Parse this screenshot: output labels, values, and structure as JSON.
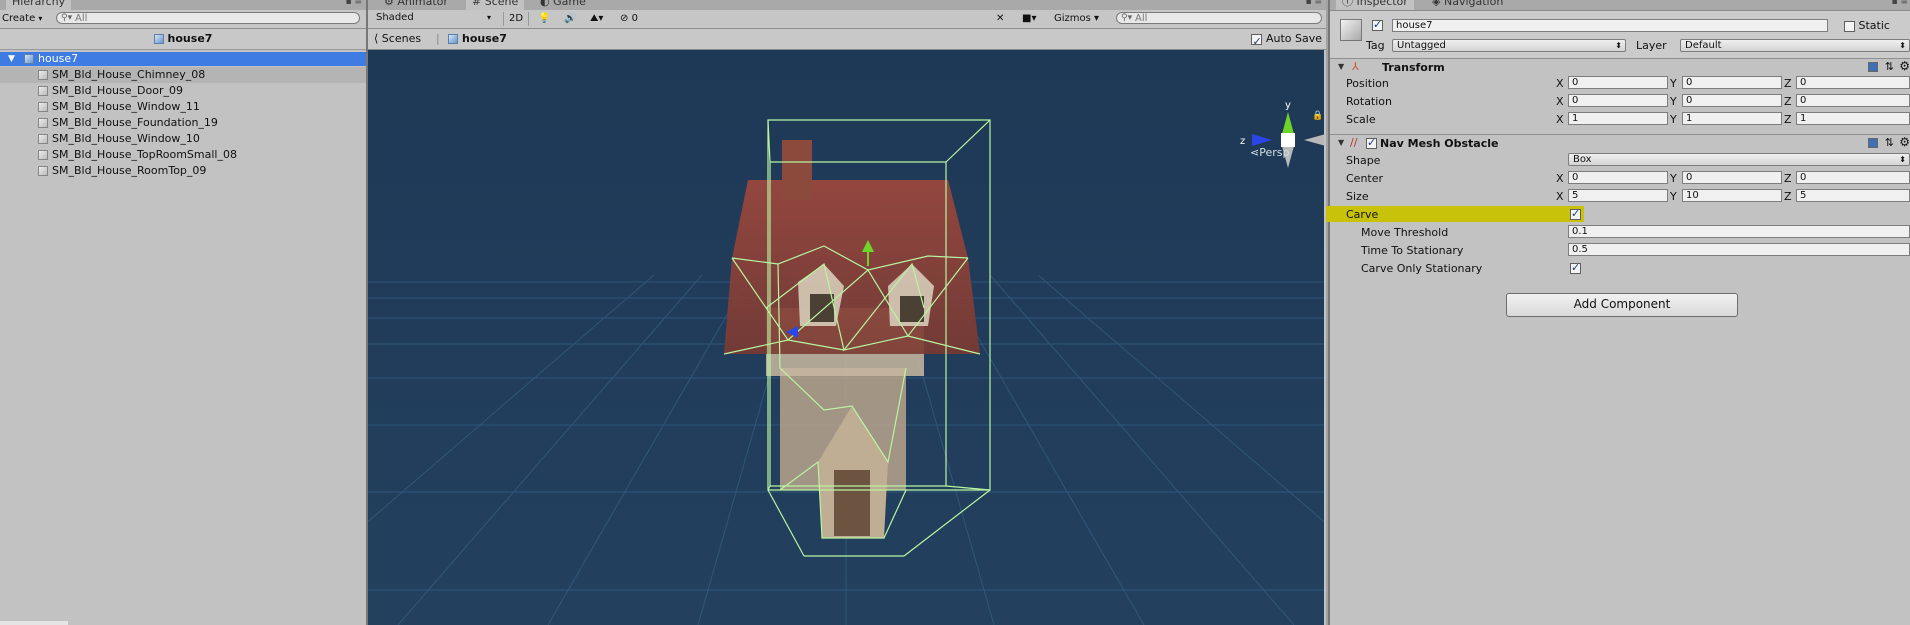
{
  "hierarchy": {
    "tab_label": "Hierarchy",
    "create_label": "Create",
    "search_placeholder": "All",
    "scene_title": "house7",
    "root_item": "house7",
    "items": [
      "SM_Bld_House_Chimney_08",
      "SM_Bld_House_Door_09",
      "SM_Bld_House_Window_11",
      "SM_Bld_House_Foundation_19",
      "SM_Bld_House_Window_10",
      "SM_Bld_House_TopRoomSmall_08",
      "SM_Bld_House_RoomTop_09"
    ]
  },
  "scene": {
    "tabs": [
      "Animator",
      "Scene",
      "Game"
    ],
    "shading_mode": "Shaded",
    "btn_2d": "2D",
    "fx_count": "0",
    "gizmos_label": "Gizmos",
    "search_placeholder": "All",
    "breadcrumb_scenes": "Scenes",
    "breadcrumb_prefab": "house7",
    "auto_save_label": "Auto Save",
    "persp_label": "Persp",
    "gizmo_axes": {
      "y": "y",
      "z": "z"
    }
  },
  "inspector": {
    "tabs": [
      "Inspector",
      "Navigation"
    ],
    "object_name": "house7",
    "static_label": "Static",
    "tag_label": "Tag",
    "tag_value": "Untagged",
    "layer_label": "Layer",
    "layer_value": "Default",
    "transform": {
      "title": "Transform",
      "position_label": "Position",
      "rotation_label": "Rotation",
      "scale_label": "Scale",
      "position": [
        "0",
        "0",
        "0"
      ],
      "rotation": [
        "0",
        "0",
        "0"
      ],
      "scale": [
        "1",
        "1",
        "1"
      ]
    },
    "navmesh": {
      "title": "Nav Mesh Obstacle",
      "shape_label": "Shape",
      "shape_value": "Box",
      "center_label": "Center",
      "center": [
        "0",
        "0",
        "0"
      ],
      "size_label": "Size",
      "size": [
        "5",
        "10",
        "5"
      ],
      "carve_label": "Carve",
      "move_threshold_label": "Move Threshold",
      "move_threshold": "0.1",
      "time_to_stationary_label": "Time To Stationary",
      "time_to_stationary": "0.5",
      "carve_only_stationary_label": "Carve Only Stationary"
    },
    "add_component_label": "Add Component",
    "axis_labels": [
      "X",
      "Y",
      "Z"
    ]
  },
  "colors": {
    "scene_bg": "#1f3a57",
    "selection": "#3e7ce4",
    "carve_highlight": "#c9c20a"
  }
}
